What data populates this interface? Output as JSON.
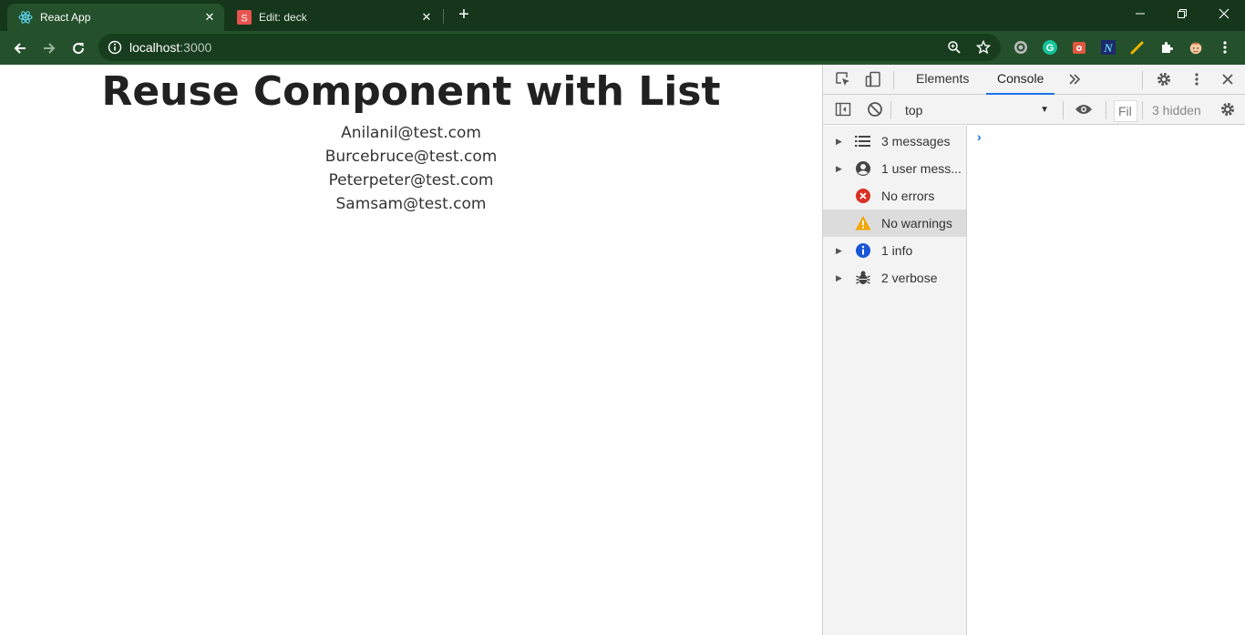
{
  "browser": {
    "tabs": [
      {
        "title": "React App",
        "active": true
      },
      {
        "title": "Edit: deck",
        "active": false
      }
    ],
    "url_host": "localhost",
    "url_port": ":3000"
  },
  "page": {
    "heading": "Reuse Component with List",
    "users": [
      "Anilanil@test.com",
      "Burcebruce@test.com",
      "Peterpeter@test.com",
      "Samsam@test.com"
    ]
  },
  "devtools": {
    "tabs": [
      "Elements",
      "Console"
    ],
    "selected_tab": "Console",
    "context": "top",
    "filter_placeholder": "Fil",
    "hidden": "3 hidden",
    "sidebar": [
      {
        "label": "3 messages",
        "icon": "list-icon",
        "expandable": true
      },
      {
        "label": "1 user mess...",
        "icon": "user-icon",
        "expandable": true
      },
      {
        "label": "No errors",
        "icon": "error-icon",
        "expandable": false
      },
      {
        "label": "No warnings",
        "icon": "warning-icon",
        "expandable": false,
        "selected": true
      },
      {
        "label": "1 info",
        "icon": "info-icon",
        "expandable": true
      },
      {
        "label": "2 verbose",
        "icon": "bug-icon",
        "expandable": true
      }
    ]
  },
  "colors": {
    "chrome_dark": "#15361a",
    "chrome_toolbar": "#24512b",
    "devtools_accent": "#1a73e8",
    "error": "#d93025",
    "warning": "#f2a600",
    "info": "#1a73e8"
  }
}
